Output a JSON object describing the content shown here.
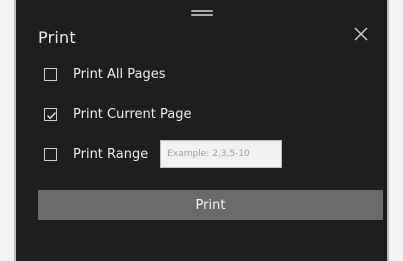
{
  "dialog": {
    "title": "Print",
    "close_icon": "close-icon",
    "drag_icon": "drag-handle-icon",
    "options": [
      {
        "label": "Print All Pages",
        "checked": false
      },
      {
        "label": "Print Current Page",
        "checked": true
      },
      {
        "label": "Print Range",
        "checked": false
      }
    ],
    "range": {
      "value": "",
      "placeholder": "Example: 2,3,5-10"
    },
    "print_button_label": "Print"
  },
  "colors": {
    "dialog_background": "#1e1e1e",
    "button_background": "#6a6a6a",
    "text": "#ececec"
  }
}
